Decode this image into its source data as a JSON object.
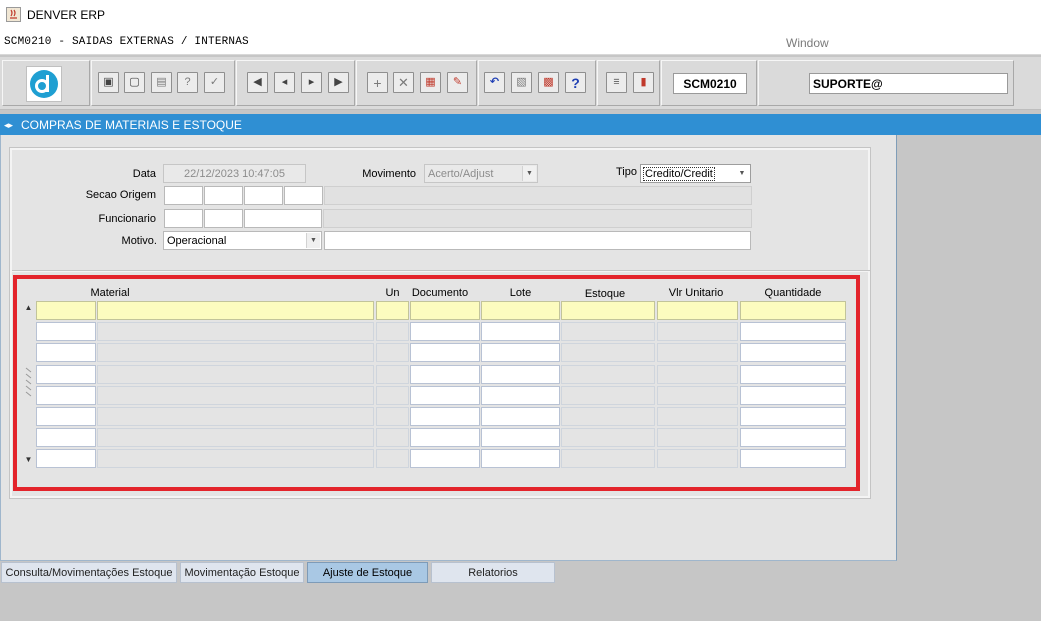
{
  "window": {
    "title": "DENVER ERP"
  },
  "menubar": {
    "form_title": "SCM0210 - SAIDAS EXTERNAS / INTERNAS",
    "window_menu": "Window"
  },
  "toolbar": {
    "form_code": "SCM0210",
    "user": "SUPORTE@"
  },
  "module": {
    "title": "COMPRAS DE MATERIAIS E ESTOQUE"
  },
  "form": {
    "data_label": "Data",
    "data_value": "22/12/2023 10:47:05",
    "movimento_label": "Movimento",
    "movimento_value": "Acerto/Adjust",
    "tipo_label": "Tipo",
    "tipo_value": "Credito/Credit",
    "secao_label": "Secao Origem",
    "funcionario_label": "Funcionario",
    "motivo_label": "Motivo.",
    "motivo_value": "Operacional"
  },
  "grid": {
    "columns": [
      "Material",
      "Un",
      "Documento",
      "Lote",
      "Estoque",
      "Vlr Unitario",
      "Quantidade"
    ],
    "row_count": 8
  },
  "tabs": [
    "Consulta/Movimentações Estoque",
    "Movimentação Estoque",
    "Ajuste de Estoque",
    "Relatorios"
  ],
  "active_tab": "Ajuste de Estoque",
  "colors": {
    "header_bar": "#2f8fd3",
    "highlight_box": "#e3242b",
    "current_row": "#fcfcbf"
  }
}
